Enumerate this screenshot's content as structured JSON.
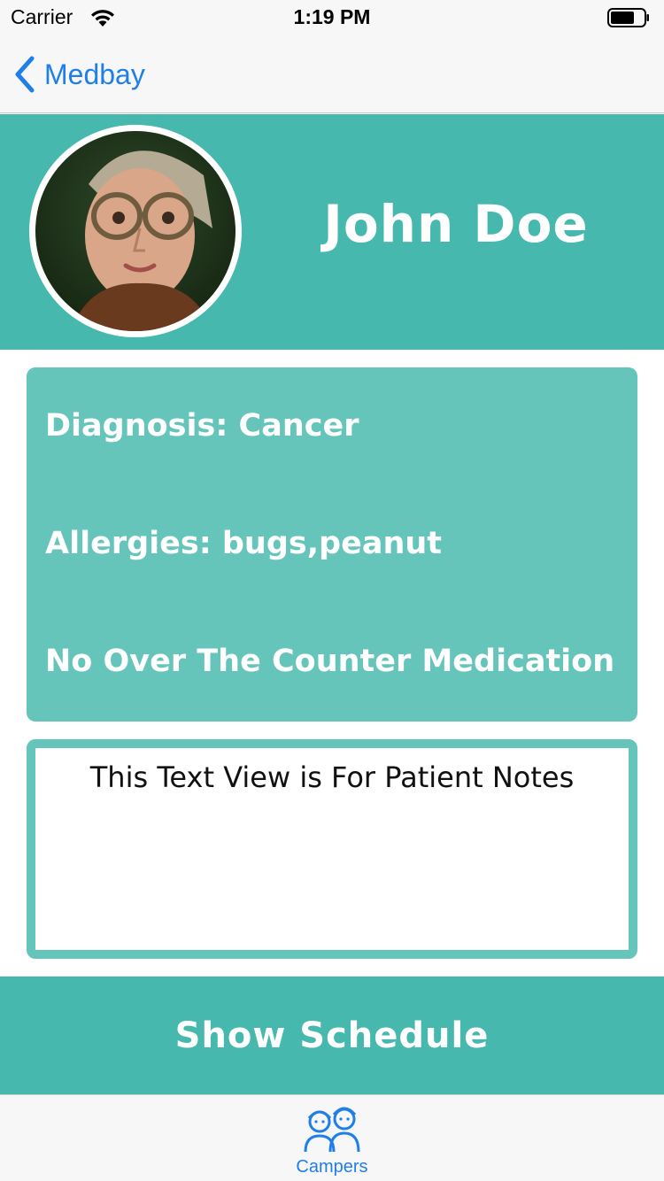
{
  "status_bar": {
    "carrier": "Carrier",
    "time": "1:19 PM",
    "wifi_icon": "wifi-icon",
    "battery_icon": "battery-icon"
  },
  "nav": {
    "back_label": "Medbay",
    "back_icon": "chevron-left-icon"
  },
  "header": {
    "name": "John Doe",
    "avatar": "patient-photo"
  },
  "info": {
    "diagnosis": "Diagnosis: Cancer",
    "allergies": "Allergies: bugs,peanut",
    "medication": "No Over The Counter Medication"
  },
  "notes": {
    "text": "This Text View is For Patient Notes"
  },
  "schedule_button": {
    "label": "Show Schedule"
  },
  "tab_bar": {
    "items": [
      {
        "label": "Campers",
        "icon": "campers-icon",
        "selected": true
      }
    ]
  },
  "colors": {
    "accent": "#46b8ad",
    "card": "#66c5bb",
    "ios_blue": "#1f7ee8"
  }
}
